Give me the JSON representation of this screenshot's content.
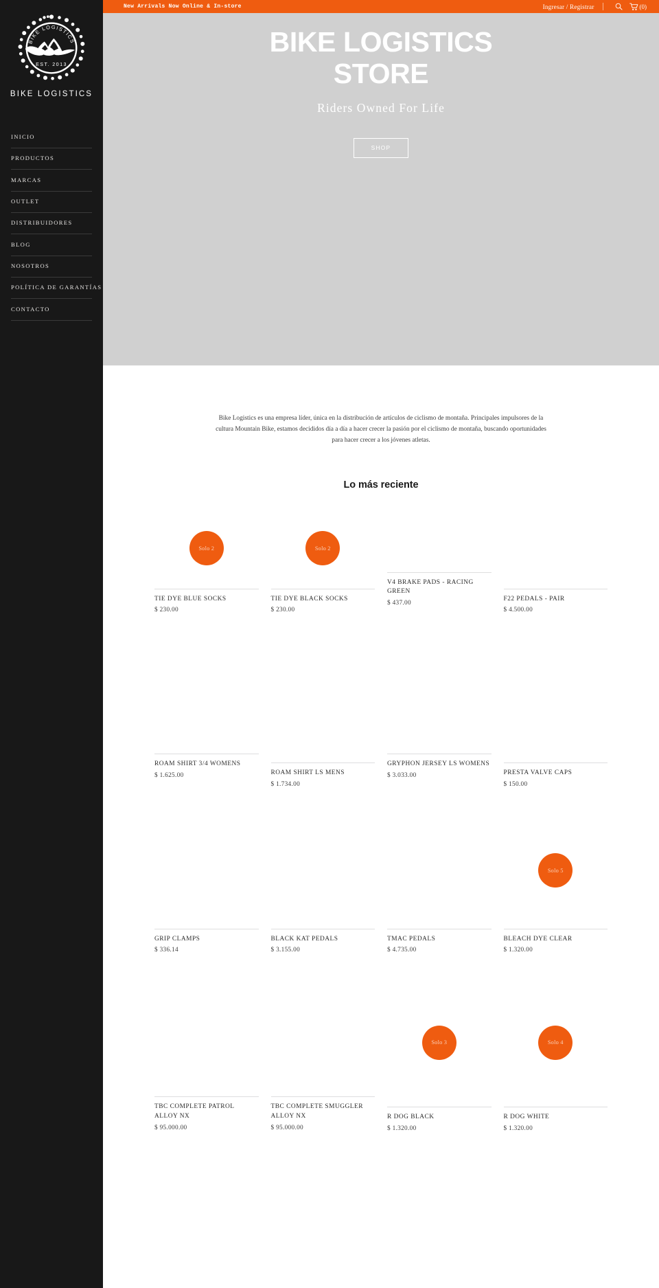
{
  "brand": {
    "logo_ring_text": "BIKE LOGISTICS",
    "logo_est": "EST. 2013",
    "wordmark": "BIKE LOGISTICS"
  },
  "sidebar": {
    "items": [
      {
        "label": "INICIO"
      },
      {
        "label": "PRODUCTOS"
      },
      {
        "label": "MARCAS"
      },
      {
        "label": "OUTLET"
      },
      {
        "label": "DISTRIBUIDORES"
      },
      {
        "label": "BLOG"
      },
      {
        "label": "NOSOTROS"
      },
      {
        "label": "POLÍTICA DE GARANTÍAS"
      },
      {
        "label": "CONTACTO"
      }
    ]
  },
  "topbar": {
    "promo": "New Arrivals Now Online & In-store",
    "account": "Ingresar / Registrar",
    "search_icon": "search-icon",
    "cart_icon": "cart-icon",
    "cart_count": "(0)",
    "background": "#ef5c10"
  },
  "hero": {
    "title": "BIKE LOGISTICS STORE",
    "subtitle": "Riders Owned For Life",
    "button": "SHOP",
    "background": "#d0d0d0"
  },
  "intro": {
    "text": "Bike Logistics es una empresa líder, única en la distribución de artículos de ciclismo de montaña. Principales impulsores de la cultura Mountain Bike, estamos decididos día a día a hacer crecer la pasión por el ciclismo de montaña, buscando oportunidades para hacer crecer a los jóvenes atletas."
  },
  "section": {
    "title": "Lo más reciente"
  },
  "accent_color": "#ef5c10",
  "products": [
    {
      "title": "TIE DYE BLUE SOCKS",
      "price": "$ 230.00",
      "badge": "Solo 2"
    },
    {
      "title": "TIE DYE BLACK SOCKS",
      "price": "$ 230.00",
      "badge": "Solo 2"
    },
    {
      "title": "V4 BRAKE PADS - RACING GREEN",
      "price": "$ 437.00",
      "badge": ""
    },
    {
      "title": "F22 PEDALS - PAIR",
      "price": "$ 4.500.00",
      "badge": ""
    },
    {
      "title": "ROAM SHIRT 3/4 WOMENS",
      "price": "$ 1.625.00",
      "badge": ""
    },
    {
      "title": "ROAM SHIRT LS MENS",
      "price": "$ 1.734.00",
      "badge": ""
    },
    {
      "title": "GRYPHON JERSEY LS WOMENS",
      "price": "$ 3.033.00",
      "badge": ""
    },
    {
      "title": "PRESTA VALVE CAPS",
      "price": "$ 150.00",
      "badge": ""
    },
    {
      "title": "GRIP CLAMPS",
      "price": "$ 336.14",
      "badge": ""
    },
    {
      "title": "BLACK KAT PEDALS",
      "price": "$ 3.155.00",
      "badge": ""
    },
    {
      "title": "TMAC PEDALS",
      "price": "$ 4.735.00",
      "badge": ""
    },
    {
      "title": "BLEACH DYE CLEAR",
      "price": "$ 1.320.00",
      "badge": "Solo 5"
    },
    {
      "title": "TBC COMPLETE PATROL ALLOY NX",
      "price": "$ 95.000.00",
      "badge": ""
    },
    {
      "title": "TBC COMPLETE SMUGGLER ALLOY NX",
      "price": "$ 95.000.00",
      "badge": ""
    },
    {
      "title": "R DOG BLACK",
      "price": "$ 1.320.00",
      "badge": "Solo 3"
    },
    {
      "title": "R DOG WHITE",
      "price": "$ 1.320.00",
      "badge": "Solo 4"
    }
  ]
}
